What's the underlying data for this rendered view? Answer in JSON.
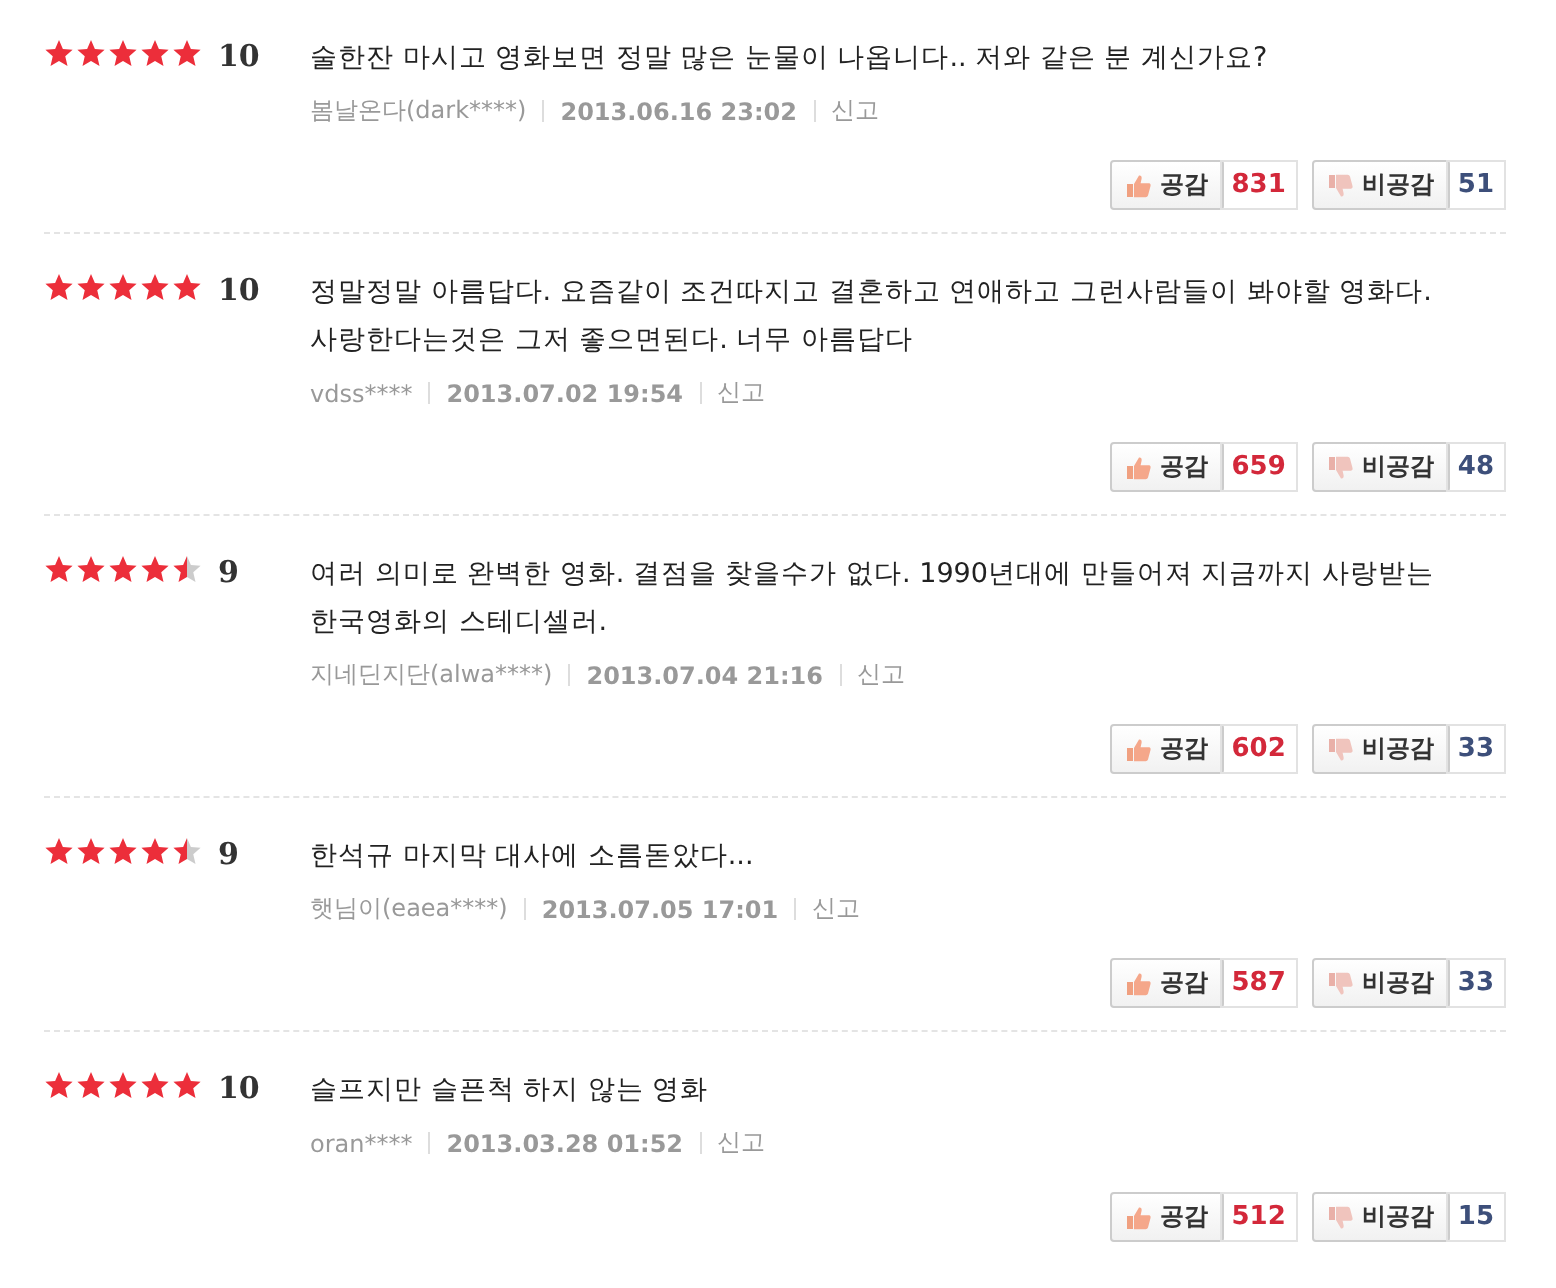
{
  "reviews": [
    {
      "stars": 5,
      "score": "10",
      "text": [
        "술한잔 마시고 영화보면 정말 많은 눈물이 나옵니다.. 저와 같은 분 계신가요?"
      ],
      "author": "봄날온다(dark****)",
      "date": "2013.06.16 23:02",
      "report": "신고",
      "like_label": "공감",
      "likes": "831",
      "dislike_label": "비공감",
      "dislikes": "51"
    },
    {
      "stars": 5,
      "score": "10",
      "text": [
        "정말정말 아름답다. 요즘같이 조건따지고 결혼하고 연애하고 그런사람들이 봐야할 영화다.",
        "사랑한다는것은 그저 좋으면된다. 너무 아름답다"
      ],
      "author": "vdss****",
      "date": "2013.07.02 19:54",
      "report": "신고",
      "like_label": "공감",
      "likes": "659",
      "dislike_label": "비공감",
      "dislikes": "48"
    },
    {
      "stars": 4.5,
      "score": "9",
      "text": [
        "여러 의미로 완벽한 영화. 결점을 찾을수가 없다. 1990년대에 만들어져 지금까지 사랑받는",
        "한국영화의 스테디셀러."
      ],
      "author": "지네딘지단(alwa****)",
      "date": "2013.07.04 21:16",
      "report": "신고",
      "like_label": "공감",
      "likes": "602",
      "dislike_label": "비공감",
      "dislikes": "33"
    },
    {
      "stars": 4.5,
      "score": "9",
      "text": [
        "한석규 마지막 대사에 소름돋았다..."
      ],
      "author": "햇님이(eaea****)",
      "date": "2013.07.05 17:01",
      "report": "신고",
      "like_label": "공감",
      "likes": "587",
      "dislike_label": "비공감",
      "dislikes": "33"
    },
    {
      "stars": 5,
      "score": "10",
      "text": [
        "슬프지만 슬픈척 하지 않는 영화"
      ],
      "author": "oran****",
      "date": "2013.03.28 01:52",
      "report": "신고",
      "like_label": "공감",
      "likes": "512",
      "dislike_label": "비공감",
      "dislikes": "15"
    }
  ]
}
